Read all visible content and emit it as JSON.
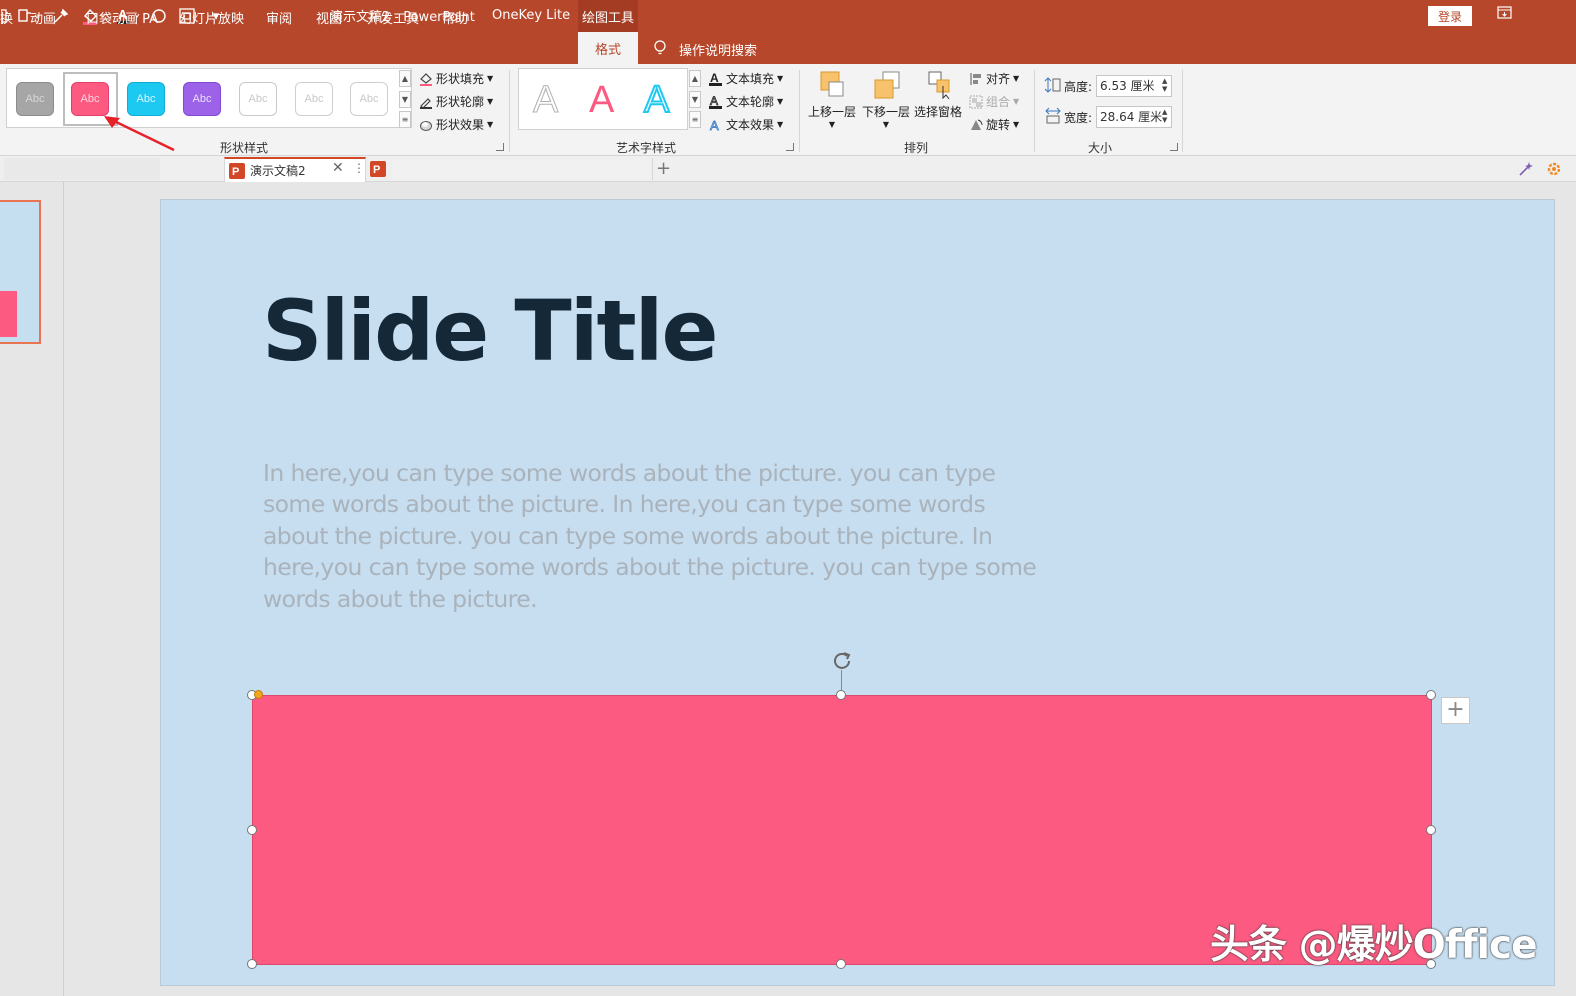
{
  "titlebar": {
    "doc_title": "演示文稿2  -  PowerPoint",
    "context_tool": "绘图工具",
    "login": "登录",
    "qat_more": "▾"
  },
  "tabs": {
    "items": [
      "换",
      "动画",
      "口袋动画 PA",
      "幻灯片放映",
      "审阅",
      "视图",
      "开发工具",
      "帮助",
      "OneKey Lite"
    ],
    "active": "格式",
    "search": "操作说明搜索"
  },
  "ribbon": {
    "shape_styles": {
      "swatch_text": "Abc",
      "fill": "形状填充",
      "outline": "形状轮廓",
      "effect": "形状效果",
      "label": "形状样式",
      "colors": {
        "gray": "#a6a6a6",
        "pink": "#fd5a81",
        "cyan": "#1ec9f1",
        "purple": "#9c62e8"
      }
    },
    "wordart": {
      "letter": "A",
      "text_fill": "文本填充",
      "text_outline": "文本轮廓",
      "text_effect": "文本效果",
      "label": "艺术字样式"
    },
    "arrange": {
      "bring_forward": "上移一层",
      "send_backward": "下移一层",
      "selection_pane": "选择窗格",
      "align": "对齐",
      "group": "组合",
      "rotate": "旋转",
      "label": "排列"
    },
    "size": {
      "height_label": "高度:",
      "height_value": "6.53 厘米",
      "width_label": "宽度:",
      "width_value": "28.64 厘米",
      "label": "大小"
    }
  },
  "doctabs": {
    "active": "演示文稿2",
    "add": "+"
  },
  "slide": {
    "title": "Slide Title",
    "body": "In here,you can type some words about the picture. you can type some words about the picture. In here,you can type some words about the picture. you can type some words about the picture. In here,you can type some words about the picture. you can type some words about the picture.",
    "shape_color": "#fd5a81",
    "background_color": "#c6def0"
  },
  "watermark": "头条 @爆炒Office"
}
